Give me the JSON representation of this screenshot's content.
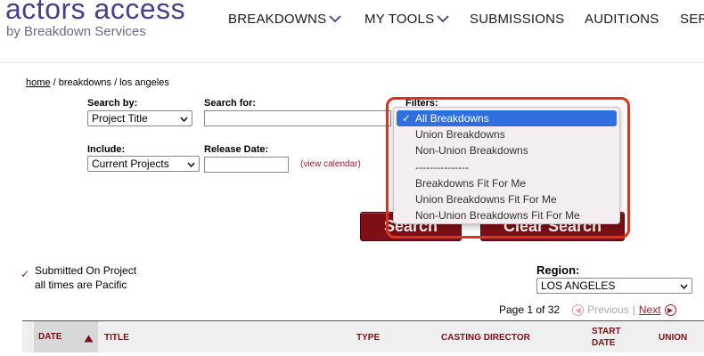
{
  "header": {
    "logo_main": "actors access",
    "logo_sub": "by Breakdown Services",
    "nav": [
      "BREAKDOWNS",
      "MY TOOLS",
      "SUBMISSIONS",
      "AUDITIONS",
      "SER"
    ]
  },
  "breadcrumb": {
    "home": "home",
    "rest": " / breakdowns / los angeles"
  },
  "form": {
    "search_by_label": "Search by:",
    "search_by_value": "Project Title",
    "search_for_label": "Search for:",
    "search_for_value": "",
    "filters_label": "Filters:",
    "include_label": "Include:",
    "include_value": "Current Projects",
    "release_date_label": "Release Date:",
    "release_date_value": "",
    "view_calendar": "(view calendar)",
    "search_button": "Search",
    "clear_button": "Clear Search"
  },
  "filter_options": [
    "All Breakdowns",
    "Union Breakdowns",
    "Non-Union Breakdowns",
    "---------------",
    "Breakdowns Fit For Me",
    "Union Breakdowns Fit For Me",
    "Non-Union Breakdowns Fit For Me"
  ],
  "filter_selected": "All Breakdowns",
  "legend": {
    "line1": "Submitted On Project",
    "line2": "all times are Pacific"
  },
  "region": {
    "label": "Region:",
    "value": "LOS ANGELES"
  },
  "pager": {
    "page_text": "Page 1 of 32",
    "previous": "Previous",
    "separator": "|",
    "next": "Next"
  },
  "table_headers": {
    "date": "DATE",
    "title": "TITLE",
    "type": "TYPE",
    "casting_director": "CASTING DIRECTOR",
    "start_date_1": "START",
    "start_date_2": "DATE",
    "union": "UNION"
  },
  "colors": {
    "brand": "#4a3d8f",
    "accent": "#7d0f17",
    "selection": "#2f6fe0",
    "callout": "#e0301e"
  }
}
